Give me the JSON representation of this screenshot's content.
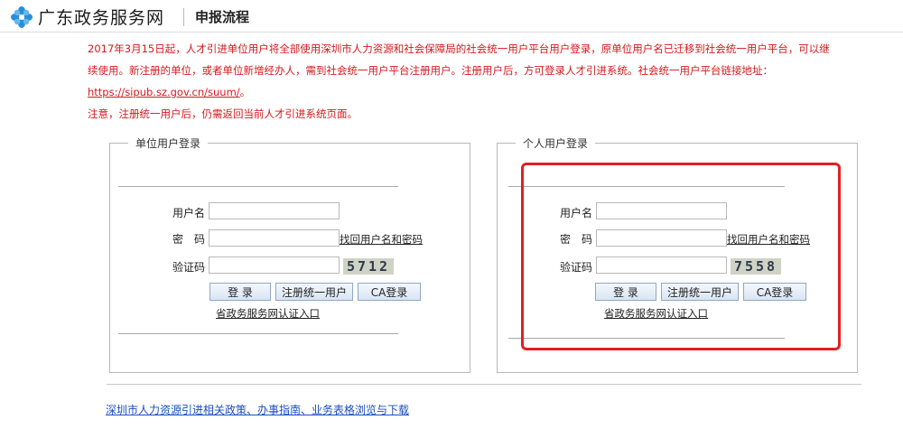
{
  "header": {
    "site_title": "广东政务服务网",
    "page_title": "申报流程",
    "logo_icon": "flower-logo-icon"
  },
  "notice": {
    "line1": "2017年3月15日起，人才引进单位用户将全部使用深圳市人力资源和社会保障局的社会统一用户平台用户登录，原单位用户名已迁移到社会统一用户平台，可以继续使用。新注册的单位，或者单位新增经办人，需到社会统一用户平台注册用户。注册用户后，方可登录人才引进系统。社会统一用户平台链接地址：",
    "link": "https://sipub.sz.gov.cn/suum/",
    "link_suffix": "。",
    "line2": "注意，注册统一用户后，仍需返回当前人才引进系统页面。"
  },
  "unit_login": {
    "legend": "单位用户登录",
    "username_label": "用户名",
    "password_label": "密　码",
    "captcha_label": "验证码",
    "recover_link": "找回用户名和密码",
    "captcha_code": "5712",
    "login_button": "登 录",
    "register_button": "注册统一用户",
    "ca_button": "CA登录",
    "portal_link": "省政务服务网认证入口"
  },
  "personal_login": {
    "legend": "个人用户登录",
    "username_label": "用户名",
    "password_label": "密　码",
    "captcha_label": "验证码",
    "recover_link": "找回用户名和密码",
    "captcha_code": "7558",
    "login_button": "登 录",
    "register_button": "注册统一用户",
    "ca_button": "CA登录",
    "portal_link": "省政务服务网认证入口"
  },
  "footer": {
    "link": "深圳市人力资源引进相关政策、办事指南、业务表格浏览与下载"
  },
  "colors": {
    "notice_red": "#d7191c",
    "highlight_red": "#e02020",
    "footer_link_blue": "#1a4fbf"
  }
}
